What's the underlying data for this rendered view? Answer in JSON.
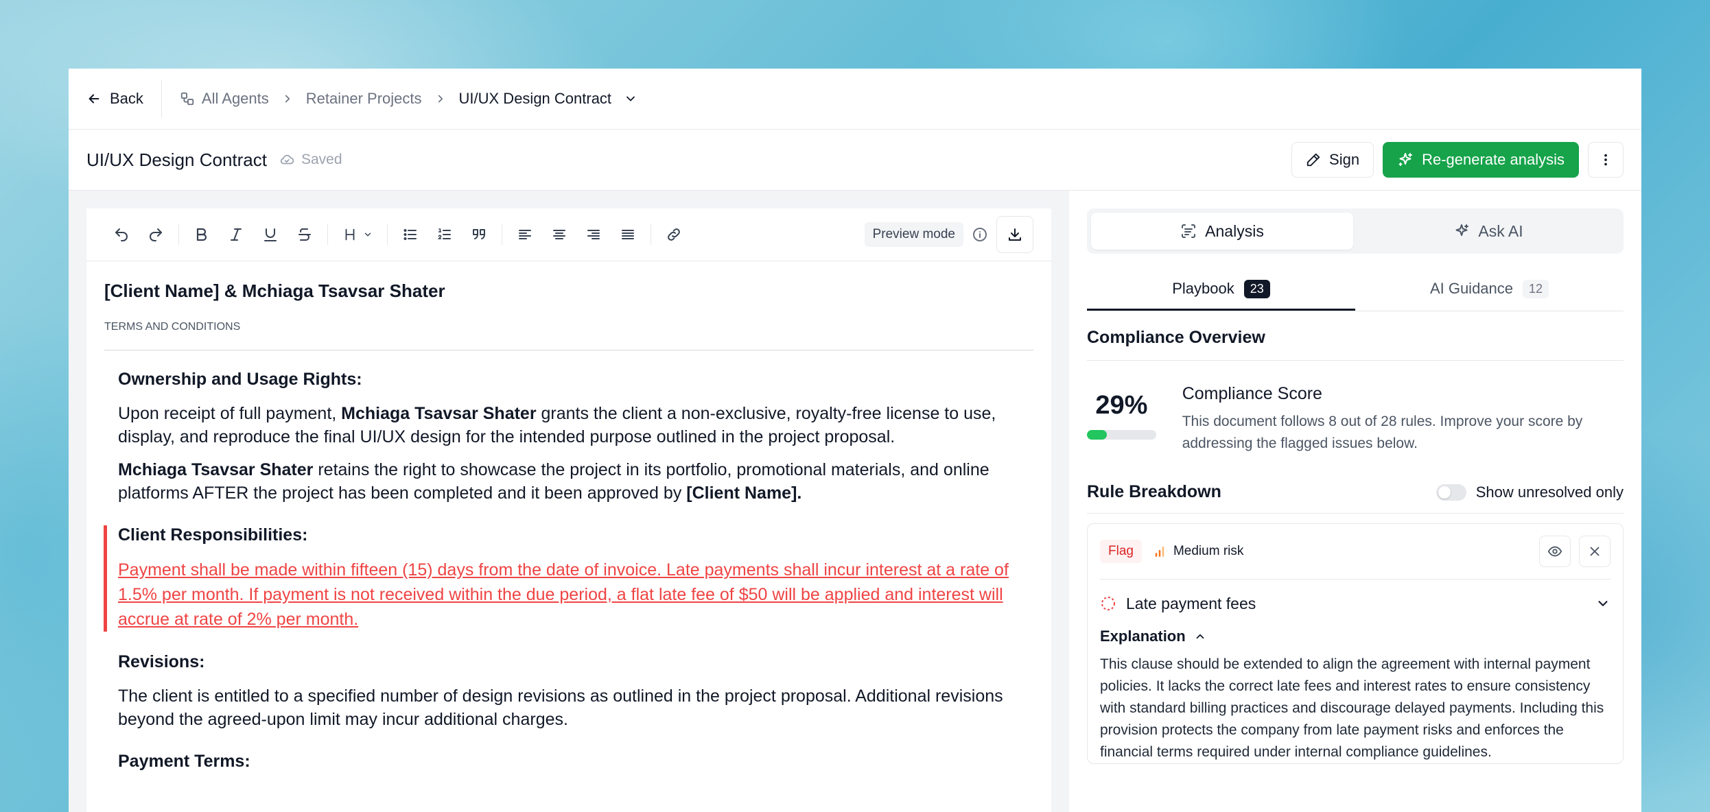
{
  "nav": {
    "back_label": "Back",
    "breadcrumbs": [
      "All Agents",
      "Retainer Projects",
      "UI/UX Design Contract"
    ]
  },
  "doc_header": {
    "title": "UI/UX Design Contract",
    "saved_label": "Saved",
    "sign_label": "Sign",
    "regenerate_label": "Re-generate analysis"
  },
  "toolbar": {
    "preview_label": "Preview mode"
  },
  "document": {
    "title": "[Client Name] & Mchiaga Tsavsar Shater",
    "subtitle": "TERMS AND CONDITIONS",
    "sections": [
      {
        "heading": "Ownership and Usage Rights:",
        "p1_a": "Upon receipt of full payment, ",
        "p1_b": "Mchiaga Tsavsar Shater",
        "p1_c": " grants the client a non-exclusive, royalty-free license to use, display, and reproduce the final UI/UX design for the intended purpose outlined in the project proposal.",
        "p2_a": "Mchiaga Tsavsar Shater",
        "p2_b": " retains the right to showcase the project in its portfolio, promotional materials, and online platforms AFTER the project has been completed and it been approved by ",
        "p2_c": "[Client Name]."
      },
      {
        "heading": "Client Responsibilities:",
        "body": "Payment shall be made within fifteen (15) days from the date of invoice. Late payments shall incur interest at a rate of 1.5% per month. If payment is not received within the due period, a flat late fee of $50 will be applied and interest will accrue at rate of 2% per month."
      },
      {
        "heading": "Revisions:",
        "body": "The client is entitled to a specified number of design revisions as outlined in the project proposal. Additional revisions beyond the agreed-upon limit may incur additional charges."
      },
      {
        "heading": "Payment Terms:"
      }
    ]
  },
  "panel": {
    "seg_analysis": "Analysis",
    "seg_ask": "Ask AI",
    "tab_playbook": "Playbook",
    "tab_playbook_count": "23",
    "tab_guidance": "AI Guidance",
    "tab_guidance_count": "12",
    "overview_title": "Compliance Overview",
    "score_pct": "29%",
    "score_value": 0.29,
    "score_title": "Compliance Score",
    "score_desc": "This document follows 8 out of 28 rules. Improve your score by addressing the flagged issues below.",
    "breakdown_title": "Rule Breakdown",
    "toggle_label": "Show unresolved only",
    "card": {
      "flag_label": "Flag",
      "risk_label": "Medium risk",
      "rule_name": "Late payment fees",
      "explanation_label": "Explanation",
      "explanation": "This clause should be extended to align the agreement with internal payment policies. It lacks the correct late fees and interest rates to ensure consistency with standard billing practices and discourage delayed payments. Including this provision protects the company from late payment risks and enforces the financial terms required under internal compliance guidelines."
    }
  },
  "colors": {
    "accent_green": "#16a34a",
    "flag_red": "#ef4444",
    "score_fill": "#22c55e",
    "risk_orange": "#f97316"
  }
}
